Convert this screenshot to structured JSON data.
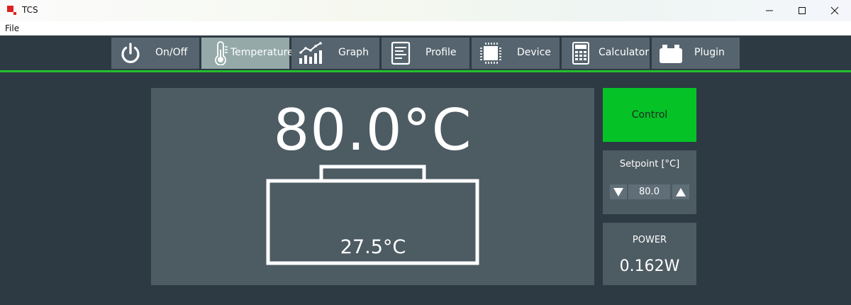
{
  "window": {
    "title": "TCS"
  },
  "menu": {
    "file": "File"
  },
  "tabs": [
    {
      "label": "On/Off",
      "icon": "power-icon"
    },
    {
      "label": "Temperature",
      "icon": "thermometer-icon",
      "active": true
    },
    {
      "label": "Graph",
      "icon": "chart-icon"
    },
    {
      "label": "Profile",
      "icon": "document-icon"
    },
    {
      "label": "Device",
      "icon": "chip-icon"
    },
    {
      "label": "Calculator",
      "icon": "calculator-icon"
    },
    {
      "label": "Plugin",
      "icon": "plugin-icon"
    }
  ],
  "display": {
    "main_temp": "80.0°C",
    "sub_temp": "27.5°C"
  },
  "control": {
    "label": "Control"
  },
  "setpoint": {
    "label": "Setpoint [°C]",
    "value": "80.0"
  },
  "power": {
    "label": "POWER",
    "value": "0.162W"
  },
  "colors": {
    "accent_green": "#05c227",
    "tab_active": "#95a9a9",
    "tab_bg": "#55646e",
    "panel_bg": "#4d5b63",
    "app_bg": "#2e3a43"
  }
}
